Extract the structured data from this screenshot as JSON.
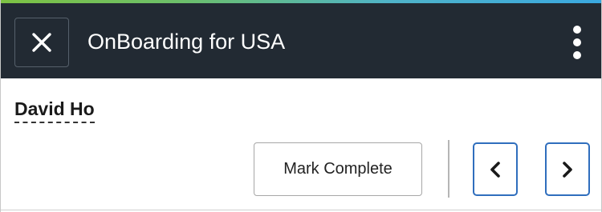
{
  "header": {
    "title": "OnBoarding for USA",
    "close_icon": "close-icon",
    "menu_icon": "vertical-ellipsis-icon",
    "background_color": "#222a33"
  },
  "person": {
    "name": "David Ho"
  },
  "actions": {
    "mark_complete_label": "Mark Complete",
    "previous_icon": "chevron-left-icon",
    "next_icon": "chevron-right-icon",
    "nav_border_color": "#2f6ebd"
  }
}
